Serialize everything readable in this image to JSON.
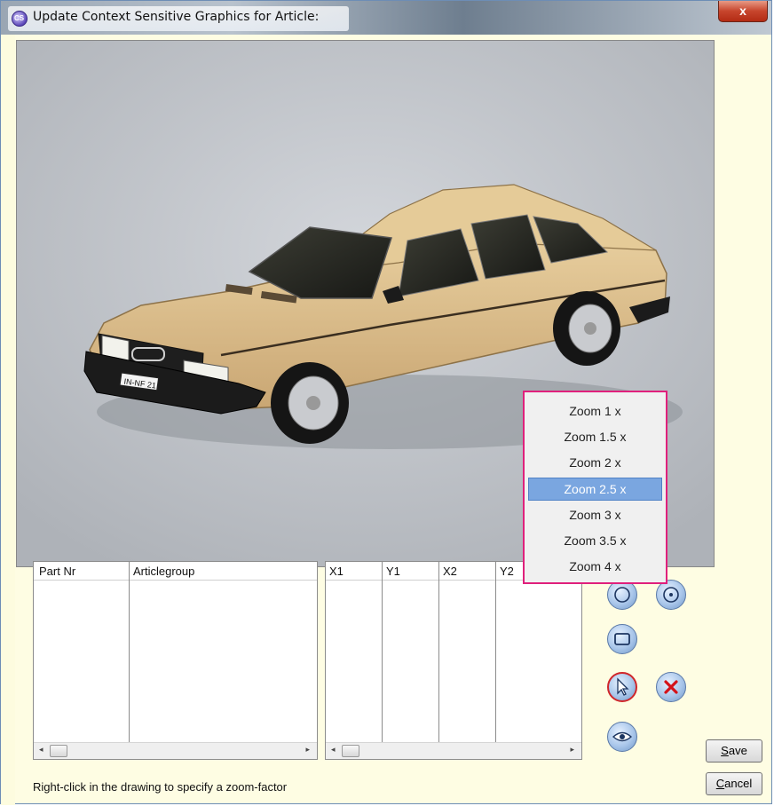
{
  "window": {
    "title": "Update Context Sensitive Graphics for Article:",
    "close_label": "x",
    "app_icon_text": "CS"
  },
  "grid_left": {
    "columns": [
      "Part Nr",
      "Articlegroup"
    ],
    "rows": []
  },
  "grid_right": {
    "columns": [
      "X1",
      "Y1",
      "X2",
      "Y2"
    ],
    "rows": []
  },
  "scroll": {
    "left_arrow": "◂",
    "right_arrow": "▸"
  },
  "context_menu": {
    "items": [
      "Zoom 1 x",
      "Zoom 1.5 x",
      "Zoom 2 x",
      "Zoom 2.5 x",
      "Zoom 3 x",
      "Zoom 3.5 x",
      "Zoom 4 x"
    ],
    "selected": "Zoom 2.5 x"
  },
  "tools": {
    "icons": [
      "circle-tool-icon",
      "point-circle-tool-icon",
      "rectangle-tool-icon",
      "pointer-tool-icon",
      "delete-icon",
      "preview-eye-icon"
    ]
  },
  "buttons": {
    "save_underline": "S",
    "save_rest": "ave",
    "cancel_underline": "C",
    "cancel_rest": "ancel"
  },
  "status_text": "Right-click in the drawing to specify a zoom-factor",
  "image": {
    "plate_text": "IN-NF 21",
    "colors": {
      "background": "#bfc3c9",
      "car_body": "#d9bc88",
      "menu_border": "#e0207c",
      "selection": "#7aa6e0"
    }
  }
}
